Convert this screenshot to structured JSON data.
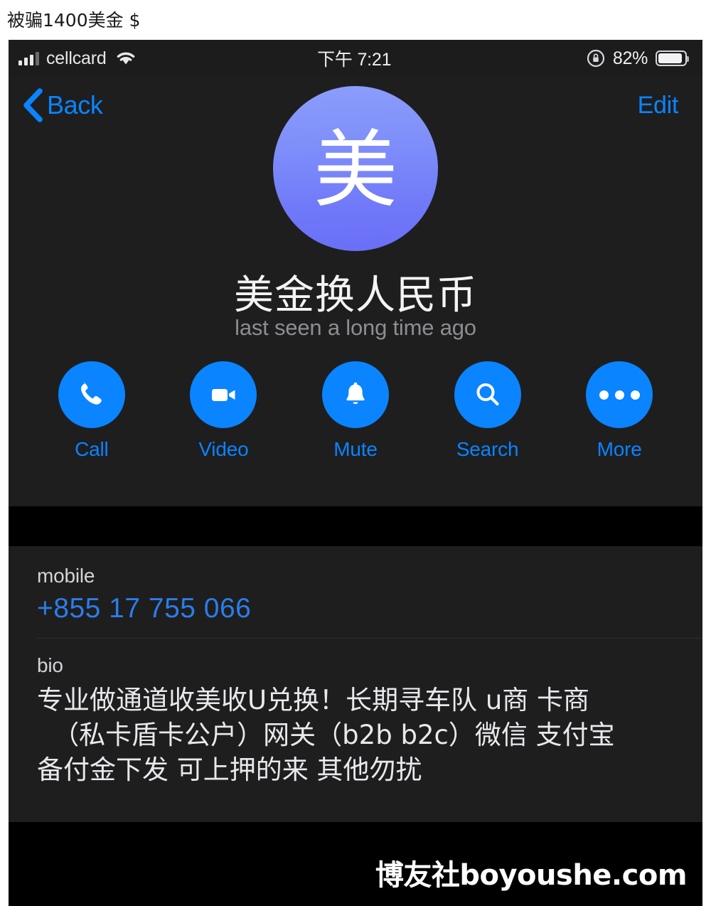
{
  "caption": {
    "text": "被骗1400美金 $"
  },
  "status_bar": {
    "signal_icon": "cellular-signal-icon",
    "carrier": "cellcard",
    "wifi_icon": "wifi-icon",
    "time": "下午 7:21",
    "lock_icon": "rotation-lock-icon",
    "battery_percent": "82%",
    "battery_icon": "battery-icon"
  },
  "navbar": {
    "back_label": "Back",
    "back_icon": "chevron-left-icon",
    "edit_label": "Edit"
  },
  "profile": {
    "avatar_initial": "美",
    "avatar_gradient_top": "#8b9dfb",
    "avatar_gradient_bottom": "#6a6ff7",
    "name": "美金换人民币",
    "status": "last seen a long time ago"
  },
  "actions": [
    {
      "icon": "phone-icon",
      "label": "Call"
    },
    {
      "icon": "video-camera-icon",
      "label": "Video"
    },
    {
      "icon": "bell-icon",
      "label": "Mute"
    },
    {
      "icon": "search-icon",
      "label": "Search"
    },
    {
      "icon": "more-dots-icon",
      "label": "More"
    }
  ],
  "info": {
    "mobile_label": "mobile",
    "mobile_value": "+855 17 755 066",
    "bio_label": "bio",
    "bio_lines": [
      "专业做通道收美收U兑换！长期寻车队 u商 卡商",
      "（私卡盾卡公户）网关（b2b b2c）微信 支付宝",
      "备付金下发 可上押的来 其他勿扰"
    ]
  },
  "watermark": {
    "text": "博友社boyoushe.com"
  },
  "colors": {
    "accent_blue": "#0a84ff",
    "link_blue": "#2b7de9",
    "card_bg": "#1e1e1f",
    "status_bar_bg": "#1c1c1d",
    "page_bg": "#000000"
  }
}
